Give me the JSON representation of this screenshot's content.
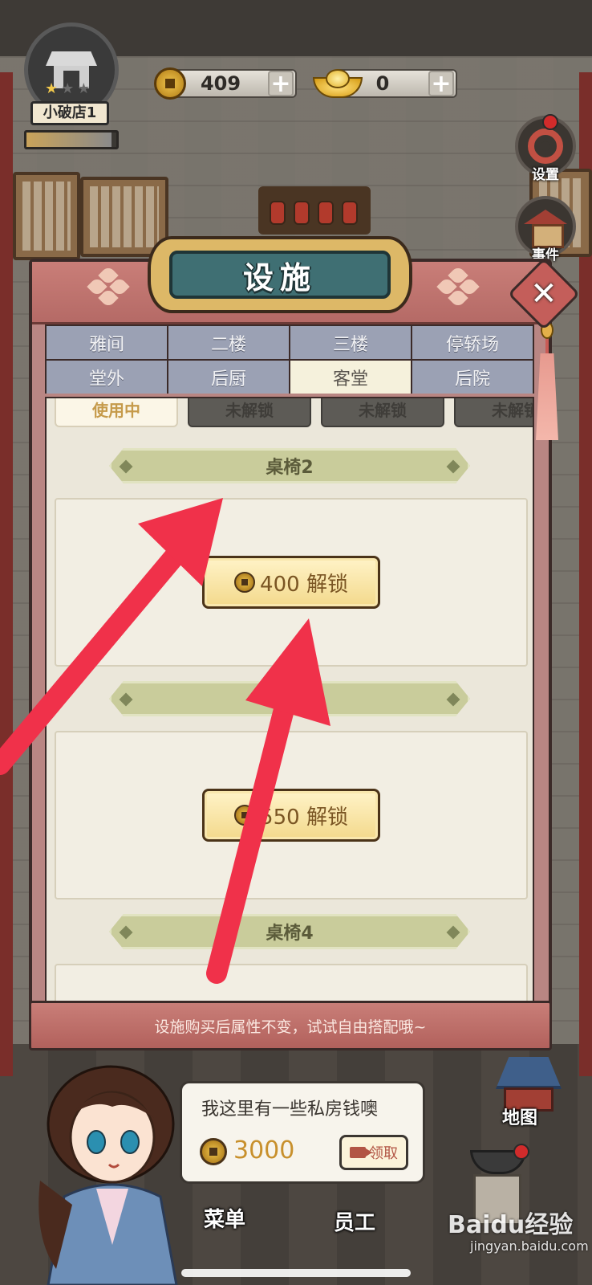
{
  "hud": {
    "shop_name": "小破店1",
    "stars": 1,
    "stars_total": 3,
    "progress": 0.95,
    "coins": "409",
    "ingots": "0",
    "plus_label": "+"
  },
  "side_buttons": {
    "settings_label": "设置",
    "events_label": "事件"
  },
  "panel": {
    "title": "设施",
    "close_label": "✕",
    "tabs_row1": [
      "雅间",
      "二楼",
      "三楼",
      "停轿场"
    ],
    "tabs_row2": [
      "堂外",
      "后厨",
      "客堂",
      "后院"
    ],
    "active_tab": "客堂",
    "status_row": [
      "使用中",
      "未解锁",
      "未解锁",
      "未解锁"
    ],
    "sections": [
      {
        "name": "桌椅2",
        "unlock_label": "400 解锁"
      },
      {
        "name": "",
        "unlock_label": "550 解锁"
      },
      {
        "name": "桌椅4"
      }
    ],
    "footer_tip": "设施购买后属性不变，试试自由搭配哦~"
  },
  "npc": {
    "message": "我这里有一些私房钱噢",
    "amount": "3000",
    "claim_label": "领取"
  },
  "bottom_nav": {
    "menu_label": "菜单",
    "staff_label": "员工",
    "map_label": "地图"
  },
  "watermark": {
    "main": "Baidu经验",
    "sub": "jingyan.baidu.com"
  },
  "colors": {
    "arrow": "#f0314a",
    "tab_active": "#f5f1dc",
    "tab_inactive": "#9ba1b4",
    "panel": "#b98683"
  }
}
